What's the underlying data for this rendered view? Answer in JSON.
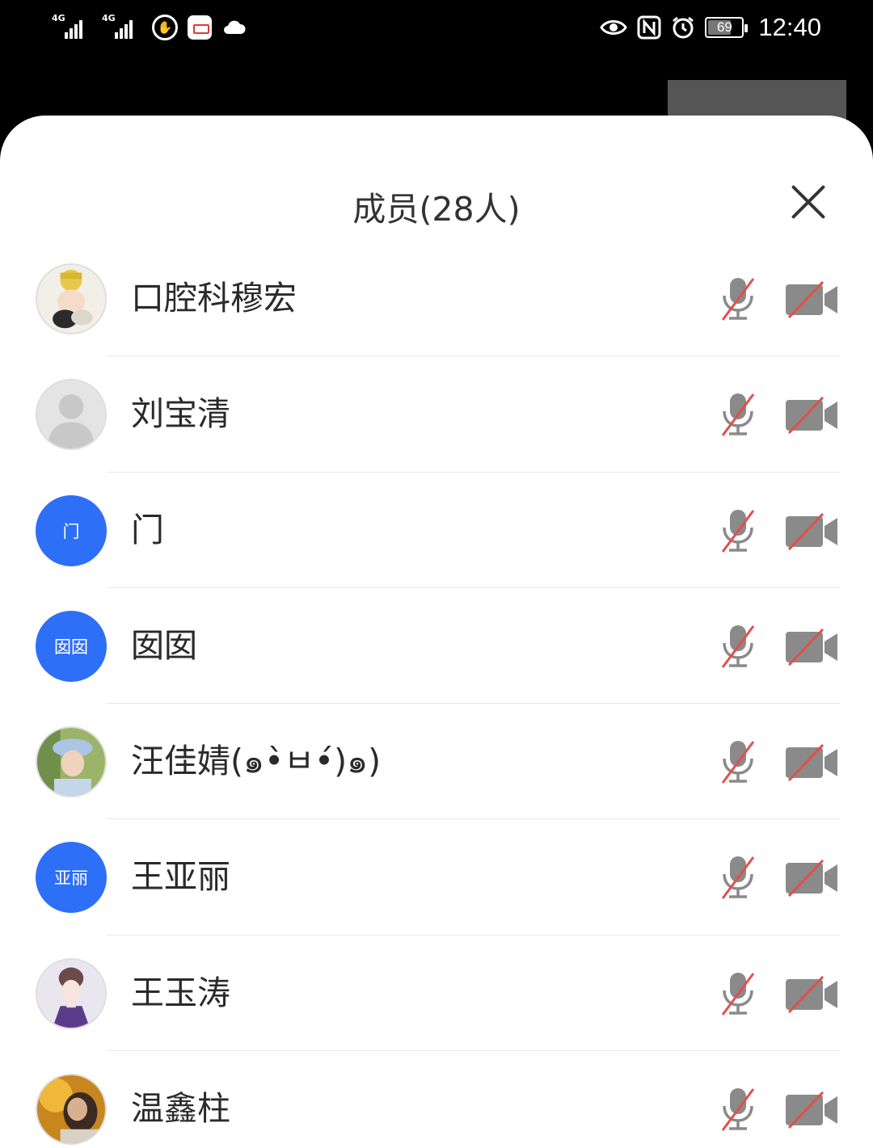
{
  "status_bar": {
    "network_1": "4G",
    "network_2": "4G",
    "battery_level": "69",
    "time": "12:40",
    "icons": [
      "signal-icon",
      "signal-icon",
      "hand-icon",
      "app-notification-icon",
      "cloud-icon",
      "eye-icon",
      "nfc-icon",
      "alarm-icon",
      "battery-icon"
    ]
  },
  "panel": {
    "title": "成员(28人)"
  },
  "members": [
    {
      "name": "口腔科穆宏",
      "avatar_type": "photo",
      "avatar_text": "",
      "mic": "muted",
      "camera": "off"
    },
    {
      "name": "刘宝清",
      "avatar_type": "default",
      "avatar_text": "",
      "mic": "muted",
      "camera": "off"
    },
    {
      "name": "门",
      "avatar_type": "text",
      "avatar_text": "门",
      "mic": "muted",
      "camera": "off"
    },
    {
      "name": "囡囡",
      "avatar_type": "text",
      "avatar_text": "囡囡",
      "mic": "muted",
      "camera": "off"
    },
    {
      "name": "汪佳婧(๑•̀ㅂ•́)๑)",
      "avatar_type": "photo",
      "avatar_text": "",
      "mic": "muted",
      "camera": "off"
    },
    {
      "name": "王亚丽",
      "avatar_type": "text",
      "avatar_text": "亚丽",
      "mic": "muted",
      "camera": "off"
    },
    {
      "name": "王玉涛",
      "avatar_type": "photo",
      "avatar_text": "",
      "mic": "muted",
      "camera": "off"
    },
    {
      "name": "温鑫柱",
      "avatar_type": "photo",
      "avatar_text": "",
      "mic": "muted",
      "camera": "off"
    }
  ],
  "colors": {
    "avatar_blue": "#2d6ff7",
    "muted_red": "#e0504a",
    "icon_gray": "#8a8a8a"
  }
}
